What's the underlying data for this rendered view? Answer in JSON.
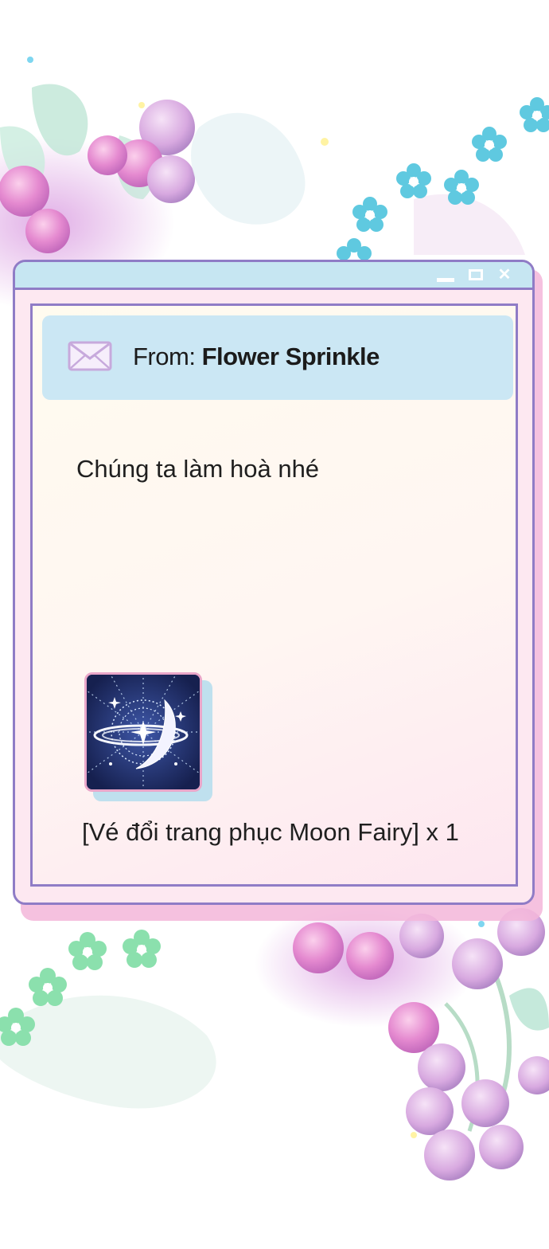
{
  "email": {
    "from_label": "From:",
    "sender": "Flower Sprinkle",
    "message": "Chúng ta làm hoà nhé",
    "attachment_label": "[Vé đổi trang phục Moon Fairy] x 1"
  },
  "window": {
    "buttons": [
      "minimize",
      "maximize",
      "close"
    ],
    "close_glyph": "✕"
  },
  "icons": {
    "mail": "envelope-icon",
    "item": "moon-fairy-ticket-icon"
  },
  "colors": {
    "frame": "#8f7cc6",
    "titlebar": "#c6e6f2",
    "from_bar": "#cbe7f4",
    "window_bg": "#fde8f1",
    "icon_bg": "#1d2b63"
  }
}
